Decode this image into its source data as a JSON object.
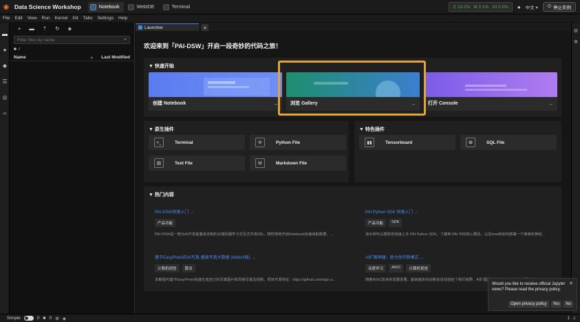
{
  "topbar": {
    "app_title": "Data Science Workshop",
    "tabs": [
      {
        "label": "Notebook",
        "active": true
      },
      {
        "label": "WebIDE",
        "active": false
      },
      {
        "label": "Terminal",
        "active": false
      }
    ],
    "resources": {
      "cpu": "C 10.2%",
      "mem": "M 2.1%",
      "gpu": "GI 0.0%"
    },
    "language": "中文",
    "stop_button": "停止实例"
  },
  "menubar": [
    "File",
    "Edit",
    "View",
    "Run",
    "Kernel",
    "Git",
    "Tabs",
    "Settings",
    "Help"
  ],
  "filebrowser": {
    "search_placeholder": "Filter files by name",
    "breadcrumb": "/",
    "col_name": "Name",
    "col_modified": "Last Modified"
  },
  "main": {
    "tab_label": "Launcher",
    "welcome": "欢迎来到「PAI-DSW」开启一段奇妙的代码之旅！",
    "quick_start": {
      "title": "▼ 快速开始",
      "cards": [
        {
          "label": "创建 Notebook",
          "arrow": "→"
        },
        {
          "label": "浏览 Gallery",
          "arrow": "→"
        },
        {
          "label": "打开 Console",
          "arrow": "→"
        }
      ]
    },
    "native": {
      "title": "▼ 原生插件",
      "items": [
        {
          "label": "Terminal",
          "icon": ">_"
        },
        {
          "label": "Python File",
          "icon": "py"
        },
        {
          "label": "Text File",
          "icon": "txt"
        },
        {
          "label": "Markdown File",
          "icon": "M"
        }
      ]
    },
    "featured": {
      "title": "▼ 特色插件",
      "items": [
        {
          "label": "Tensorboard",
          "icon": "bar"
        },
        {
          "label": "SQL File",
          "icon": "sql"
        }
      ]
    },
    "hot": {
      "title": "▼ 热门内容",
      "items": [
        {
          "title": "PAI-DSW快速入门 →",
          "tags": [
            "产品功能"
          ],
          "desc": "PAI-DSW是一款为AI开发者量身定制的云端机器学习交互式开发IDE，随时随地开启Notebook快速读取数据、..."
        },
        {
          "title": "PAI Python SDK 快速入门 →",
          "tags": [
            "产品功能",
            "SDK"
          ],
          "desc": "该示例可以帮助你快速上手 PAI Python SDK，了解到 PAI 中的核心概念，以及how到如何部署一个简单的神经..."
        },
        {
          "title": "基于EasyPhoto的AI写真-基础写真大数据 (WebUI版) →",
          "tags": [
            "计算机视觉",
            "算法"
          ],
          "desc": "本教程可基于EasyPhoto快速生成自己的写真图片和风格写真及视频。项目开源地址：https://github.com/aigc-a..."
        },
        {
          "title": "AI扩图神器：助力创作新模式 →",
          "tags": [
            "深度学习",
            "AIGC",
            "计算机视觉"
          ],
          "desc": "随着AIGC技术的发展发展，越来越多的创新找活动送给了我们视野，AI扩图是其中之一。本文将介绍使用Stable..."
        }
      ]
    }
  },
  "toast": {
    "message": "Would you like to receive official Jupyter news? Please read the privacy policy.",
    "open_policy": "Open privacy policy",
    "yes": "Yes",
    "no": "No"
  },
  "statusbar": {
    "mode": "Simple",
    "count1": "0",
    "count2": "0",
    "right": "1"
  }
}
